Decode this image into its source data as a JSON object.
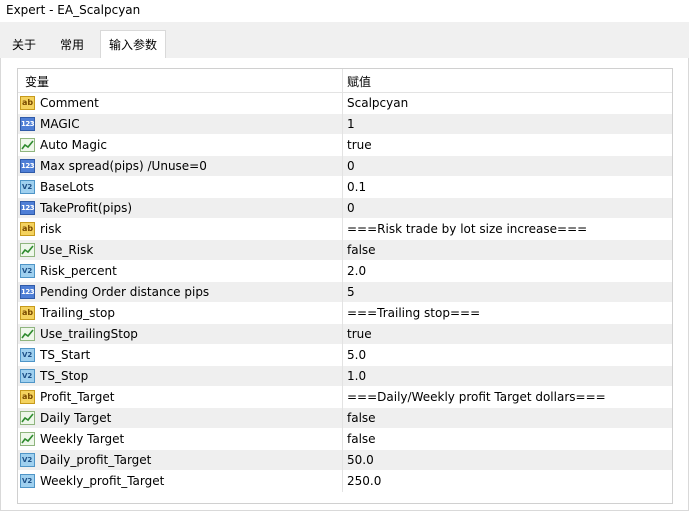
{
  "window": {
    "title": "Expert - EA_Scalpcyan"
  },
  "tabs": [
    {
      "label": "关于"
    },
    {
      "label": "常用"
    },
    {
      "label": "输入参数"
    }
  ],
  "grid": {
    "headers": {
      "variable": "变量",
      "value": "赋值"
    },
    "rows": [
      {
        "icon": "string-icon",
        "name": "Comment",
        "value": "Scalpcyan"
      },
      {
        "icon": "integer-icon",
        "name": "MAGIC",
        "value": "1"
      },
      {
        "icon": "bool-icon",
        "name": "Auto Magic",
        "value": "true"
      },
      {
        "icon": "integer-icon",
        "name": "Max spread(pips) /Unuse=0",
        "value": "0"
      },
      {
        "icon": "double-icon",
        "name": "BaseLots",
        "value": "0.1"
      },
      {
        "icon": "integer-icon",
        "name": "TakeProfit(pips)",
        "value": "0"
      },
      {
        "icon": "string-icon",
        "name": "risk",
        "value": "===Risk trade by lot size increase==="
      },
      {
        "icon": "bool-icon",
        "name": "Use_Risk",
        "value": "false"
      },
      {
        "icon": "double-icon",
        "name": "Risk_percent",
        "value": "2.0"
      },
      {
        "icon": "integer-icon",
        "name": "Pending Order distance pips",
        "value": "5"
      },
      {
        "icon": "string-icon",
        "name": "Trailing_stop",
        "value": "===Trailing stop==="
      },
      {
        "icon": "bool-icon",
        "name": "Use_trailingStop",
        "value": "true"
      },
      {
        "icon": "double-icon",
        "name": "TS_Start",
        "value": "5.0"
      },
      {
        "icon": "double-icon",
        "name": "TS_Stop",
        "value": "1.0"
      },
      {
        "icon": "string-icon",
        "name": "Profit_Target",
        "value": "===Daily/Weekly profit Target dollars==="
      },
      {
        "icon": "bool-icon",
        "name": "Daily Target",
        "value": "false"
      },
      {
        "icon": "bool-icon",
        "name": "Weekly Target",
        "value": "false"
      },
      {
        "icon": "double-icon",
        "name": "Daily_profit_Target",
        "value": "50.0"
      },
      {
        "icon": "double-icon",
        "name": "Weekly_profit_Target",
        "value": "250.0"
      }
    ]
  }
}
